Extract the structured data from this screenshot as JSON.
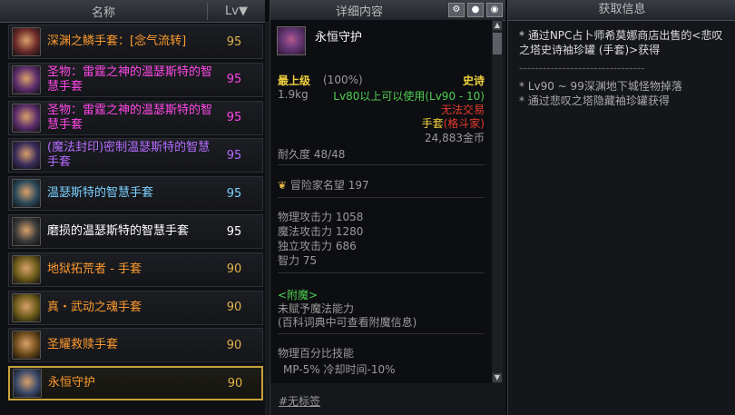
{
  "left": {
    "header_name": "名称",
    "header_lv": "Lv▼",
    "items": [
      {
        "name": "深渊之鳞手套：[念气流转]",
        "level": "95",
        "color": "#ff9a2e",
        "icon": "gauntlet-icon"
      },
      {
        "name": "圣物：雷霆之神的温瑟斯特的智慧手套",
        "level": "95",
        "color": "#ff48e8",
        "icon": "gauntlet-icon"
      },
      {
        "name": "圣物：雷霆之神的温瑟斯特的智慧手套",
        "level": "95",
        "color": "#ff48e8",
        "icon": "gauntlet-icon"
      },
      {
        "name": "(魔法封印)密制温瑟斯特的智慧手套",
        "level": "95",
        "color": "#b46bff",
        "icon": "gauntlet-icon"
      },
      {
        "name": "温瑟斯特的智慧手套",
        "level": "95",
        "color": "#7ad0ff",
        "icon": "gauntlet-icon"
      },
      {
        "name": "磨损的温瑟斯特的智慧手套",
        "level": "95",
        "color": "#ffffff",
        "icon": "gauntlet-icon"
      },
      {
        "name": "地狱拓荒者 - 手套",
        "level": "90",
        "color": "#ff9a2e",
        "icon": "gauntlet-icon"
      },
      {
        "name": "真・武动之魂手套",
        "level": "90",
        "color": "#ff9a2e",
        "icon": "gauntlet-icon"
      },
      {
        "name": "圣耀救赎手套",
        "level": "90",
        "color": "#ff9a2e",
        "icon": "gauntlet-icon"
      },
      {
        "name": "永恒守护",
        "level": "90",
        "color": "#ff9a2e",
        "icon": "gauntlet-icon"
      }
    ]
  },
  "detail": {
    "header": "详细内容",
    "title": "永恒守护",
    "grade_label": "最上级",
    "grade_pct": "(100%)",
    "rarity": "史诗",
    "weight": "1.9kg",
    "level_req": "Lv80以上可以使用(Lv90 - 10)",
    "trade": "无法交易",
    "slot": "手套",
    "job": "(格斗家)",
    "price": "24,883金币",
    "durability": "耐久度 48/48",
    "fame": "冒险家名望 197",
    "stats": [
      "物理攻击力 1058",
      "魔法攻击力 1280",
      "独立攻击力 686",
      "智力 75"
    ],
    "enchant_header": "<附魔>",
    "enchant_lines": [
      "未赋予魔法能力",
      "(百科词典中可查看附魔信息)"
    ],
    "skill_header": "物理百分比技能",
    "skill_line": "MP-5% 冷却时间-10%",
    "tag": "#无标签"
  },
  "right": {
    "header": "获取信息",
    "main_text": "* 通过NPC占卜师希莫娜商店出售的<悲叹之塔史诗袖珍罐 (手套)>获得",
    "divider": "--------------------------------",
    "sources": [
      "* Lv90 ~ 99深渊地下城怪物掉落",
      "* 通过悲叹之塔隐藏袖珍罐获得"
    ]
  }
}
